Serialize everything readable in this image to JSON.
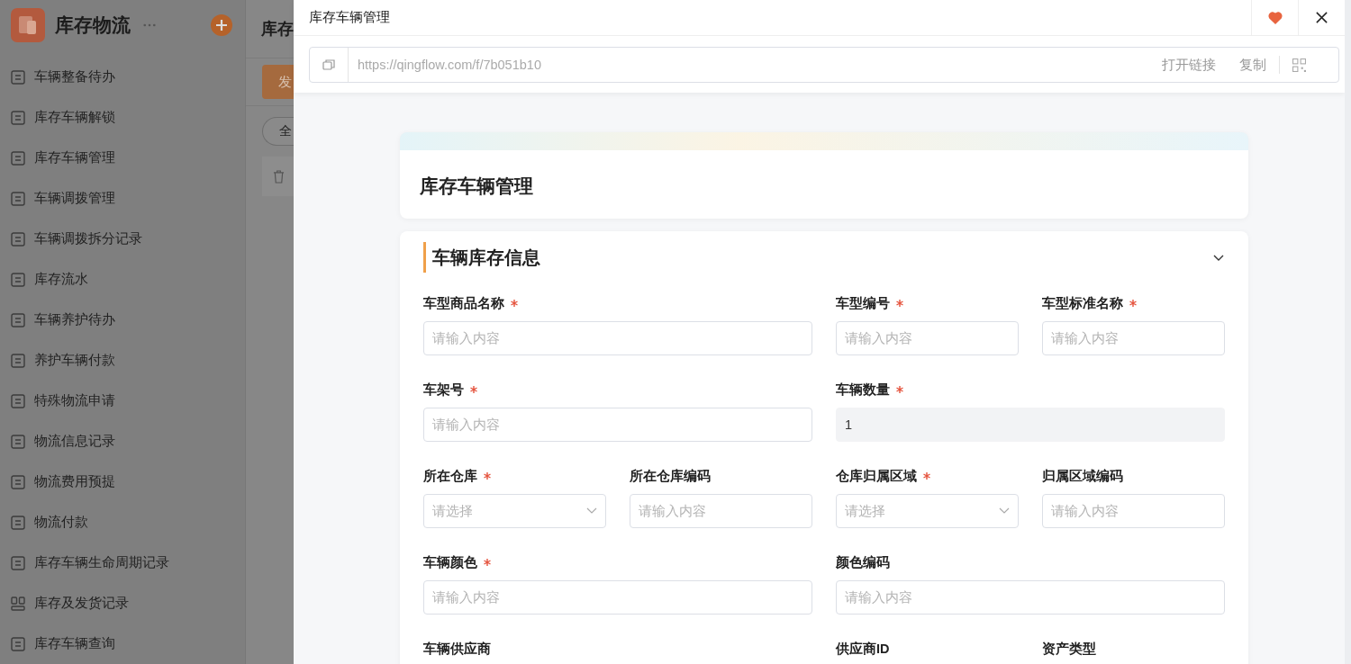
{
  "sidebar": {
    "title": "库存物流",
    "items": [
      {
        "label": "车辆整备待办",
        "kind": "list"
      },
      {
        "label": "库存车辆解锁",
        "kind": "list"
      },
      {
        "label": "库存车辆管理",
        "kind": "list"
      },
      {
        "label": "车辆调拨管理",
        "kind": "list"
      },
      {
        "label": "车辆调拨拆分记录",
        "kind": "list"
      },
      {
        "label": "库存流水",
        "kind": "list"
      },
      {
        "label": "车辆养护待办",
        "kind": "list"
      },
      {
        "label": "养护车辆付款",
        "kind": "list"
      },
      {
        "label": "特殊物流申请",
        "kind": "list"
      },
      {
        "label": "物流信息记录",
        "kind": "list"
      },
      {
        "label": "物流费用预提",
        "kind": "list"
      },
      {
        "label": "物流付款",
        "kind": "list"
      },
      {
        "label": "库存车辆生命周期记录",
        "kind": "list"
      },
      {
        "label": "库存及发货记录",
        "kind": "dashboard"
      },
      {
        "label": "库存车辆查询",
        "kind": "list"
      }
    ]
  },
  "background_panel": {
    "title": "库存",
    "button": "发",
    "filter": "全"
  },
  "modal": {
    "title": "库存车辆管理",
    "favorite": true,
    "url": "https://qingflow.com/f/7b051b10",
    "open_link": "打开链接",
    "copy": "复制"
  },
  "form": {
    "title": "库存车辆管理",
    "section": {
      "title": "车辆库存信息",
      "expanded": true,
      "fields": [
        {
          "label": "车型商品名称",
          "required": true,
          "kind": "input",
          "placeholder": "请输入内容",
          "wide": true
        },
        {
          "label": "车型编号",
          "required": true,
          "kind": "input",
          "placeholder": "请输入内容",
          "wide": false
        },
        {
          "label": "车型标准名称",
          "required": true,
          "kind": "input",
          "placeholder": "请输入内容",
          "wide": false
        },
        {
          "label": "车架号",
          "required": true,
          "kind": "input",
          "placeholder": "请输入内容",
          "wide": true
        },
        {
          "label": "车辆数量",
          "required": true,
          "kind": "readonly",
          "value": "1",
          "wide": true
        },
        {
          "label": "所在仓库",
          "required": true,
          "kind": "select",
          "placeholder": "请选择",
          "wide": false
        },
        {
          "label": "所在仓库编码",
          "required": false,
          "kind": "input",
          "placeholder": "请输入内容",
          "wide": false
        },
        {
          "label": "仓库归属区域",
          "required": true,
          "kind": "select",
          "placeholder": "请选择",
          "wide": false
        },
        {
          "label": "归属区域编码",
          "required": false,
          "kind": "input",
          "placeholder": "请输入内容",
          "wide": false
        },
        {
          "label": "车辆颜色",
          "required": true,
          "kind": "input",
          "placeholder": "请输入内容",
          "wide": true
        },
        {
          "label": "颜色编码",
          "required": false,
          "kind": "input",
          "placeholder": "请输入内容",
          "wide": true
        },
        {
          "label": "车辆供应商",
          "required": false
        },
        {
          "label": "供应商ID",
          "required": false
        },
        {
          "label": "资产类型",
          "required": false
        }
      ]
    }
  }
}
